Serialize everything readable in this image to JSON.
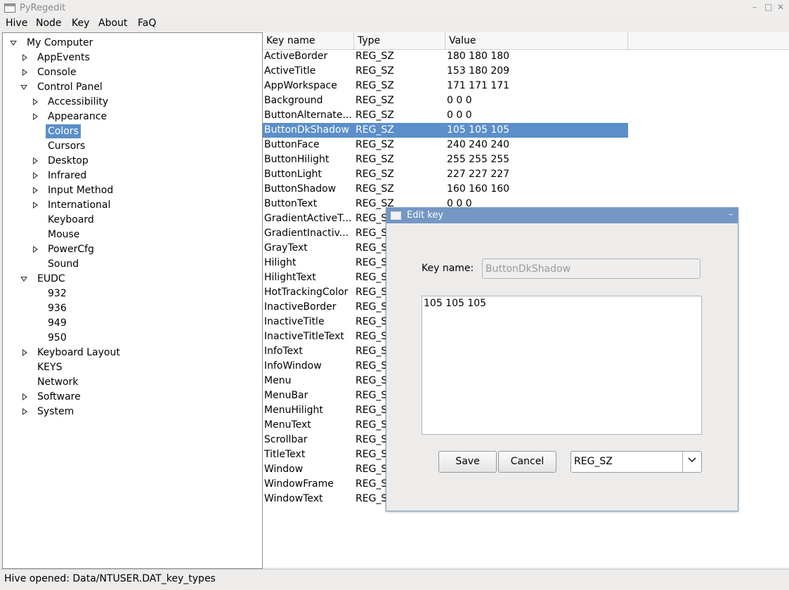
{
  "window": {
    "title": "PyRegedit",
    "controls": [
      "–",
      "□",
      "✕"
    ]
  },
  "menu": [
    "Hive",
    "Node",
    "Key",
    "About",
    "FaQ"
  ],
  "tree": [
    {
      "label": "My Computer",
      "indent": 0,
      "toggle": "expanded"
    },
    {
      "label": "AppEvents",
      "indent": 1,
      "toggle": "collapsed"
    },
    {
      "label": "Console",
      "indent": 1,
      "toggle": "collapsed"
    },
    {
      "label": "Control Panel",
      "indent": 1,
      "toggle": "expanded"
    },
    {
      "label": "Accessibility",
      "indent": 2,
      "toggle": "collapsed"
    },
    {
      "label": "Appearance",
      "indent": 2,
      "toggle": "collapsed"
    },
    {
      "label": "Colors",
      "indent": 2,
      "toggle": "none",
      "selected": true
    },
    {
      "label": "Cursors",
      "indent": 2,
      "toggle": "none"
    },
    {
      "label": "Desktop",
      "indent": 2,
      "toggle": "collapsed"
    },
    {
      "label": "Infrared",
      "indent": 2,
      "toggle": "collapsed"
    },
    {
      "label": "Input Method",
      "indent": 2,
      "toggle": "collapsed"
    },
    {
      "label": "International",
      "indent": 2,
      "toggle": "collapsed"
    },
    {
      "label": "Keyboard",
      "indent": 2,
      "toggle": "none"
    },
    {
      "label": "Mouse",
      "indent": 2,
      "toggle": "none"
    },
    {
      "label": "PowerCfg",
      "indent": 2,
      "toggle": "collapsed"
    },
    {
      "label": "Sound",
      "indent": 2,
      "toggle": "none"
    },
    {
      "label": "EUDC",
      "indent": 1,
      "toggle": "expanded"
    },
    {
      "label": "932",
      "indent": 2,
      "toggle": "none"
    },
    {
      "label": "936",
      "indent": 2,
      "toggle": "none"
    },
    {
      "label": "949",
      "indent": 2,
      "toggle": "none"
    },
    {
      "label": "950",
      "indent": 2,
      "toggle": "none"
    },
    {
      "label": "Keyboard Layout",
      "indent": 1,
      "toggle": "collapsed"
    },
    {
      "label": "KEYS",
      "indent": 1,
      "toggle": "none"
    },
    {
      "label": "Network",
      "indent": 1,
      "toggle": "none"
    },
    {
      "label": "Software",
      "indent": 1,
      "toggle": "collapsed"
    },
    {
      "label": "System",
      "indent": 1,
      "toggle": "collapsed"
    }
  ],
  "table": {
    "headers": [
      "Key name",
      "Type",
      "Value"
    ],
    "rows": [
      {
        "name": "ActiveBorder",
        "type": "REG_SZ",
        "value": "180 180 180"
      },
      {
        "name": "ActiveTitle",
        "type": "REG_SZ",
        "value": "153 180 209"
      },
      {
        "name": "AppWorkspace",
        "type": "REG_SZ",
        "value": "171 171 171"
      },
      {
        "name": "Background",
        "type": "REG_SZ",
        "value": "0 0 0"
      },
      {
        "name": "ButtonAlternate...",
        "type": "REG_SZ",
        "value": "0 0 0"
      },
      {
        "name": "ButtonDkShadow",
        "type": "REG_SZ",
        "value": "105 105 105",
        "selected": true
      },
      {
        "name": "ButtonFace",
        "type": "REG_SZ",
        "value": "240 240 240"
      },
      {
        "name": "ButtonHilight",
        "type": "REG_SZ",
        "value": "255 255 255"
      },
      {
        "name": "ButtonLight",
        "type": "REG_SZ",
        "value": "227 227 227"
      },
      {
        "name": "ButtonShadow",
        "type": "REG_SZ",
        "value": "160 160 160"
      },
      {
        "name": "ButtonText",
        "type": "REG_SZ",
        "value": "0 0 0"
      },
      {
        "name": "GradientActiveT...",
        "type": "REG_S",
        "value": ""
      },
      {
        "name": "GradientInactiv...",
        "type": "REG_S",
        "value": ""
      },
      {
        "name": "GrayText",
        "type": "REG_S",
        "value": ""
      },
      {
        "name": "Hilight",
        "type": "REG_S",
        "value": ""
      },
      {
        "name": "HilightText",
        "type": "REG_S",
        "value": ""
      },
      {
        "name": "HotTrackingColor",
        "type": "REG_S",
        "value": ""
      },
      {
        "name": "InactiveBorder",
        "type": "REG_S",
        "value": ""
      },
      {
        "name": "InactiveTitle",
        "type": "REG_S",
        "value": ""
      },
      {
        "name": "InactiveTitleText",
        "type": "REG_S",
        "value": ""
      },
      {
        "name": "InfoText",
        "type": "REG_S",
        "value": ""
      },
      {
        "name": "InfoWindow",
        "type": "REG_S",
        "value": ""
      },
      {
        "name": "Menu",
        "type": "REG_S",
        "value": ""
      },
      {
        "name": "MenuBar",
        "type": "REG_S",
        "value": ""
      },
      {
        "name": "MenuHilight",
        "type": "REG_S",
        "value": ""
      },
      {
        "name": "MenuText",
        "type": "REG_S",
        "value": ""
      },
      {
        "name": "Scrollbar",
        "type": "REG_S",
        "value": ""
      },
      {
        "name": "TitleText",
        "type": "REG_S",
        "value": ""
      },
      {
        "name": "Window",
        "type": "REG_S",
        "value": ""
      },
      {
        "name": "WindowFrame",
        "type": "REG_S",
        "value": ""
      },
      {
        "name": "WindowText",
        "type": "REG_S",
        "value": ""
      }
    ]
  },
  "dialog": {
    "title": "Edit key",
    "minimize": "–",
    "key_name_label": "Key name:",
    "key_name_value": "ButtonDkShadow",
    "value_text": "105 105 105",
    "save_label": "Save",
    "cancel_label": "Cancel",
    "type_selected": "REG_SZ"
  },
  "status": "Hive opened: Data/NTUSER.DAT_key_types",
  "colors": {
    "selection": "#5b8fc9",
    "dialog_title": "#7497c4"
  }
}
